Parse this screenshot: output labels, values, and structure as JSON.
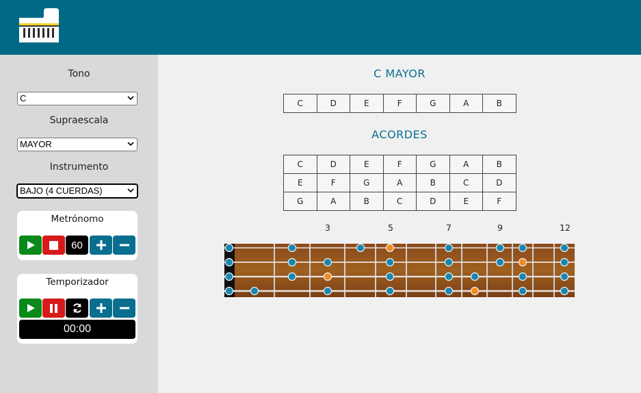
{
  "header": {
    "logo_icon": "piano-icon",
    "color": "#006a86"
  },
  "sidebar": {
    "tone_label": "Tono",
    "tone_value": "C",
    "scale_label": "Supraescala",
    "scale_value": "MAYOR",
    "instrument_label": "Instrumento",
    "instrument_value": "BAJO (4 CUERDAS)",
    "metronome": {
      "title": "Metrónomo",
      "bpm": "60"
    },
    "timer": {
      "title": "Temporizador",
      "time": "00:00"
    }
  },
  "main": {
    "scale_title": "C MAYOR",
    "scale_notes": [
      "C",
      "D",
      "E",
      "F",
      "G",
      "A",
      "B"
    ],
    "chords_title": "ACORDES",
    "chord_rows": [
      [
        "C",
        "D",
        "E",
        "F",
        "G",
        "A",
        "B"
      ],
      [
        "E",
        "F",
        "G",
        "A",
        "B",
        "C",
        "D"
      ],
      [
        "G",
        "A",
        "B",
        "C",
        "D",
        "E",
        "F"
      ]
    ],
    "fret_numbers": [
      "3",
      "5",
      "7",
      "9",
      "12"
    ]
  },
  "colors": {
    "accent": "#0a6f8f",
    "root_dot": "#f5891f",
    "note_dot": "#1a86ad"
  }
}
